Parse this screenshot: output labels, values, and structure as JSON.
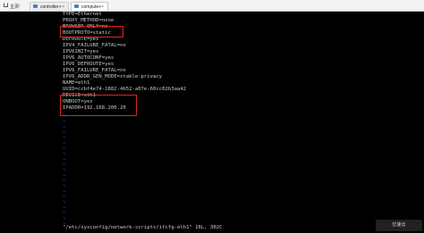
{
  "tabs": {
    "home_label": "主页",
    "items": [
      {
        "label": "controller+"
      },
      {
        "label": "compute+"
      }
    ],
    "close_glyph": "×"
  },
  "editor": {
    "lines": [
      "TYPE=Ethernet",
      "PROXY_METHOD=none",
      "BROWSER_ONLY=no",
      "BOOTPROTO=static",
      "DEFROUTE=yes",
      "IPV4_FAILURE_FATAL=no",
      "IPV6INIT=yes",
      "IPV6_AUTOCONF=yes",
      "IPV6_DEFROUTE=yes",
      "IPV6_FAILURE_FATAL=no",
      "IPV6_ADDR_GEN_MODE=stable-privacy",
      "NAME=eth1",
      "UUID=ccbf4e74-1882-4b52-a07e-60cc02b3aa42",
      "DEVICE=eth1",
      "ONBOOT=yes",
      "IPADDR=192.168.200.20"
    ],
    "tilde": "~",
    "tilde_count": 21,
    "status": "\"/etc/sysconfig/network-scripts/ifcfg-eth1\" 16L, 302C"
  },
  "watermark": "亿速云"
}
